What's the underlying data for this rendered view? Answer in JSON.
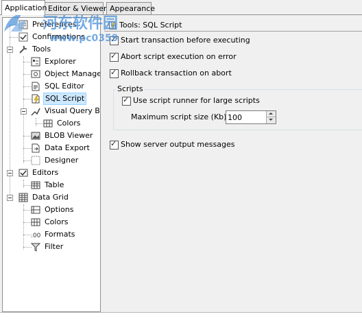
{
  "tabs": [
    {
      "label": "Application"
    },
    {
      "label": "Editor & Viewers"
    },
    {
      "label": "Appearance"
    }
  ],
  "tree": {
    "items": [
      {
        "label": "Preferences",
        "icon": "preferences-icon"
      },
      {
        "label": "Confirmations",
        "icon": "confirmations-icon"
      },
      {
        "label": "Tools",
        "icon": "tools-icon"
      },
      {
        "label": "Explorer",
        "icon": "explorer-icon"
      },
      {
        "label": "Object Manager",
        "icon": "object-manager-icon"
      },
      {
        "label": "SQL Editor",
        "icon": "sql-editor-icon"
      },
      {
        "label": "SQL Script",
        "icon": "sql-script-icon"
      },
      {
        "label": "Visual Query Build",
        "icon": "visual-query-builder-icon"
      },
      {
        "label": "Colors",
        "icon": "colors-icon"
      },
      {
        "label": "BLOB Viewer",
        "icon": "blob-viewer-icon"
      },
      {
        "label": "Data Export",
        "icon": "data-export-icon"
      },
      {
        "label": "Designer",
        "icon": "designer-icon"
      },
      {
        "label": "Editors",
        "icon": "editors-icon"
      },
      {
        "label": "Table",
        "icon": "table-icon"
      },
      {
        "label": "Data Grid",
        "icon": "data-grid-icon"
      },
      {
        "label": "Options",
        "icon": "options-icon"
      },
      {
        "label": "Colors",
        "icon": "colors-icon"
      },
      {
        "label": "Formats",
        "icon": "formats-icon"
      },
      {
        "label": "Filter",
        "icon": "filter-icon"
      }
    ]
  },
  "content": {
    "header": "Tools: SQL Script",
    "options": {
      "start_transaction": {
        "label": "Start transaction before executing",
        "checked": true
      },
      "abort_on_error": {
        "label": "Abort script execution on error",
        "checked": true
      },
      "rollback_on_abort": {
        "label": "Rollback transaction on abort",
        "checked": true
      }
    },
    "scripts_group": {
      "title": "Scripts",
      "use_runner": {
        "label": "Use script runner for large scripts",
        "checked": true
      },
      "max_size_label": "Maximum script size (Kb)",
      "max_size_value": "100"
    },
    "server_output": {
      "label": "Show server output messages",
      "checked": true
    }
  },
  "watermark": {
    "line1": "河东软件园",
    "line2": "www.pc0359"
  },
  "colors": {
    "selection_bg": "#cce8ff",
    "watermark": "#4a90d9"
  }
}
